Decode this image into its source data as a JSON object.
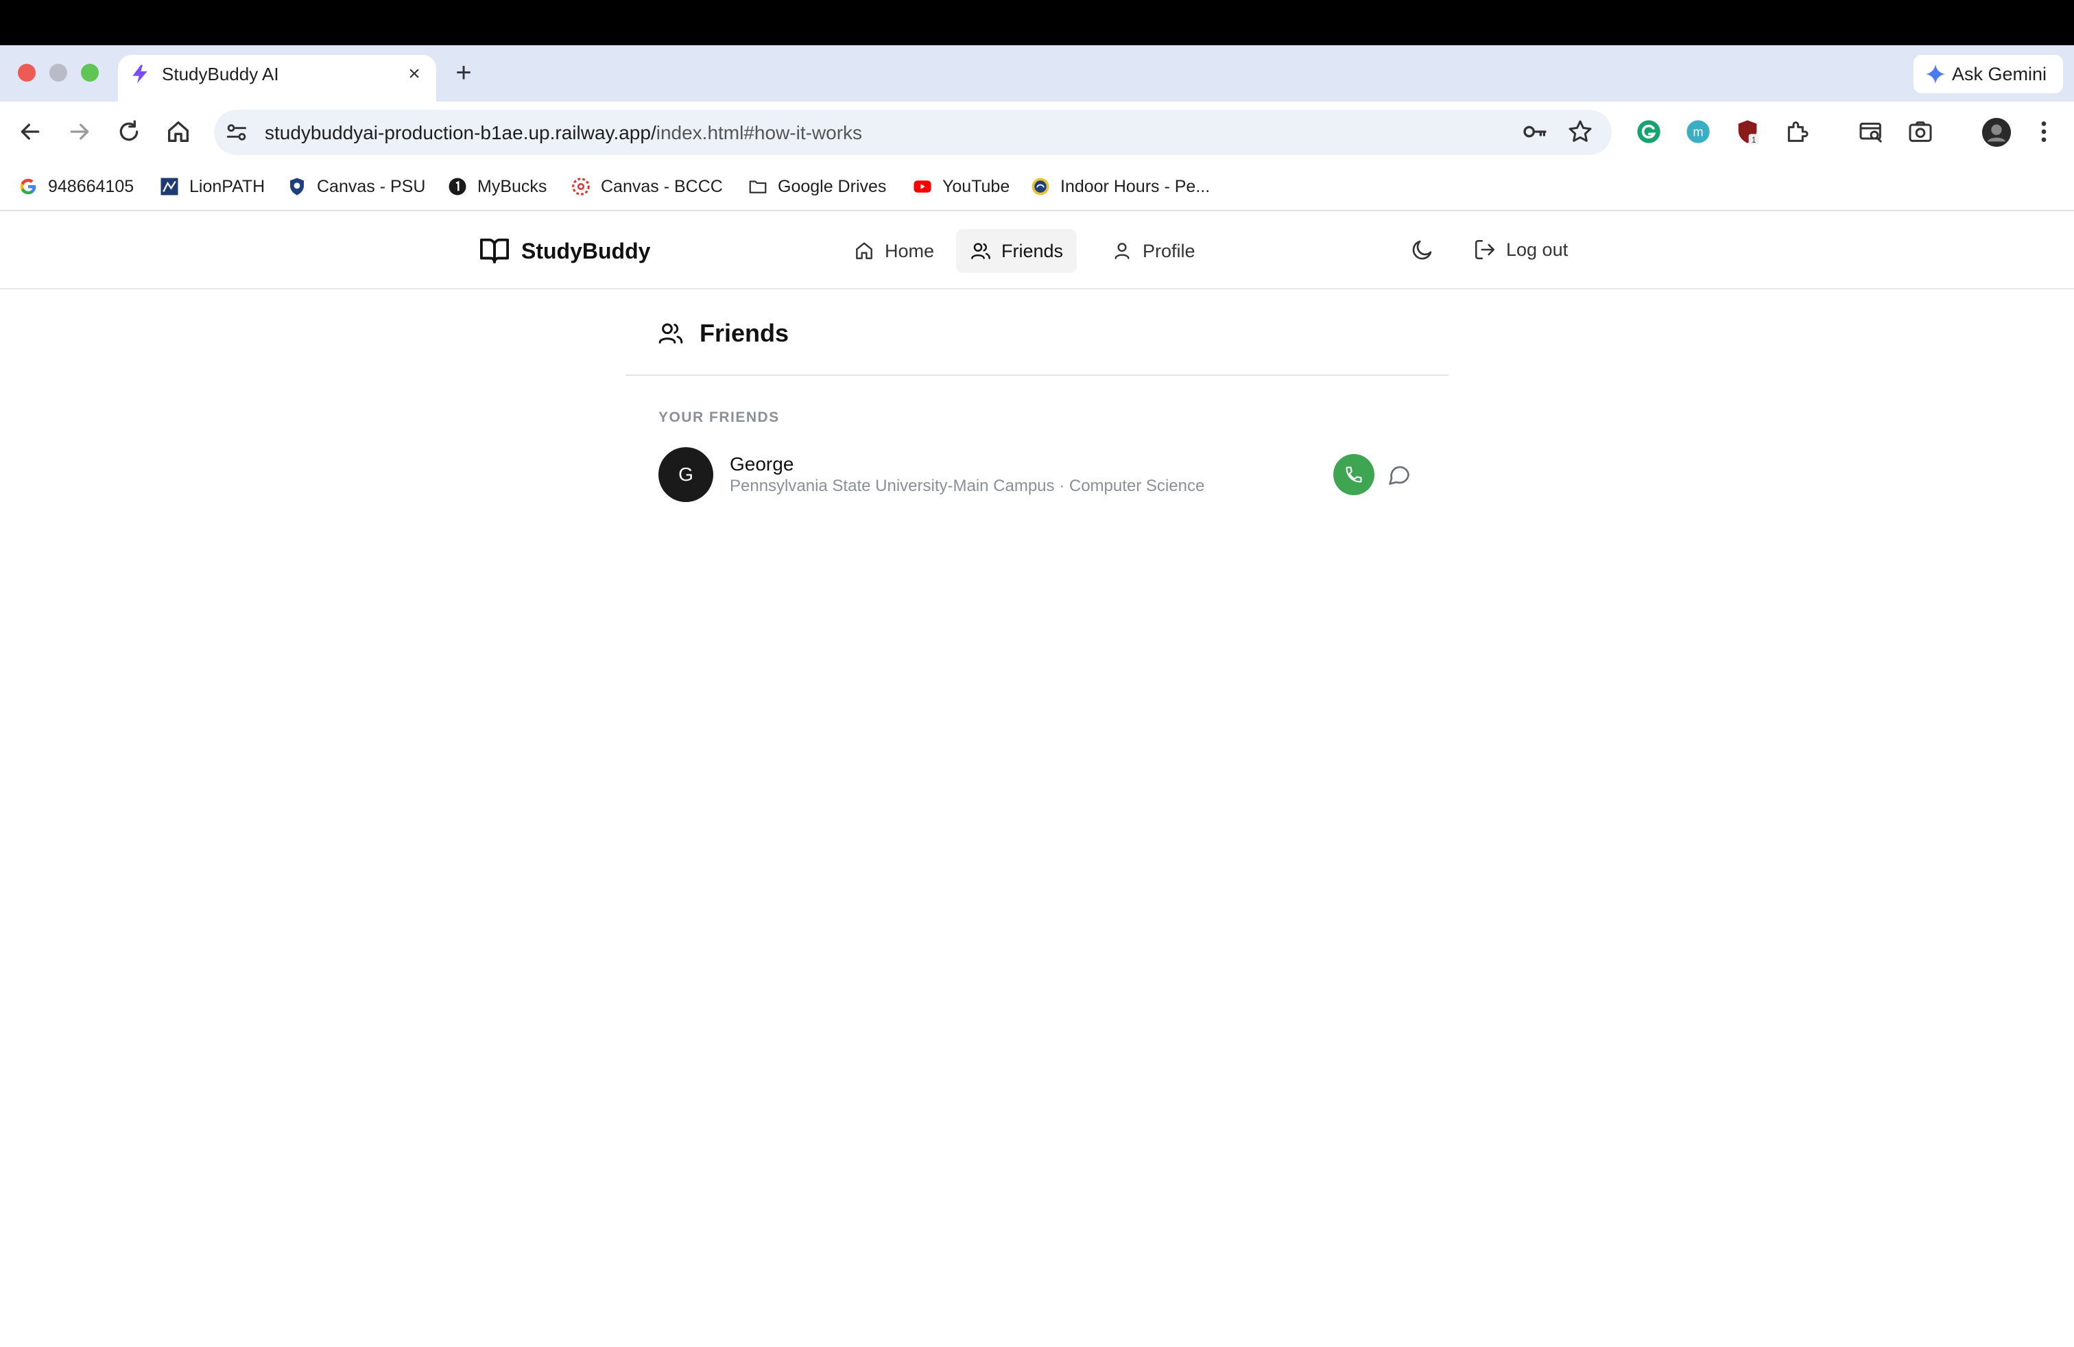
{
  "browser": {
    "tab_title": "StudyBuddy AI",
    "tab_close": "×",
    "new_tab": "+",
    "gemini_label": "Ask Gemini",
    "url_host": "studybuddyai-production-b1ae.up.railway.app/",
    "url_path": "index.html#how-it-works",
    "bookmarks": [
      {
        "label": "948664105",
        "icon": "google-icon"
      },
      {
        "label": "LionPATH",
        "icon": "lionpath-icon"
      },
      {
        "label": "Canvas - PSU",
        "icon": "psu-shield-icon"
      },
      {
        "label": "MyBucks",
        "icon": "mybucks-icon"
      },
      {
        "label": "Canvas - BCCC",
        "icon": "canvas-icon"
      },
      {
        "label": "Google Drives",
        "icon": "folder-icon"
      },
      {
        "label": "YouTube",
        "icon": "youtube-icon"
      },
      {
        "label": "Indoor Hours - Pe...",
        "icon": "psu-lion-icon"
      }
    ],
    "extension_badge": "1"
  },
  "app": {
    "brand": "StudyBuddy",
    "nav": [
      {
        "label": "Home",
        "icon": "home-icon",
        "active": false
      },
      {
        "label": "Friends",
        "icon": "users-icon",
        "active": true
      },
      {
        "label": "Profile",
        "icon": "user-icon",
        "active": false
      }
    ],
    "logout_label": "Log out"
  },
  "main": {
    "title": "Friends",
    "section_label": "YOUR FRIENDS",
    "friends": [
      {
        "initial": "G",
        "name": "George",
        "meta": "Pennsylvania State University-Main Campus · Computer Science"
      }
    ]
  },
  "colors": {
    "call_button": "#3ea653",
    "tabstrip": "#dfe7f7",
    "avatar": "#1a1a1a"
  }
}
